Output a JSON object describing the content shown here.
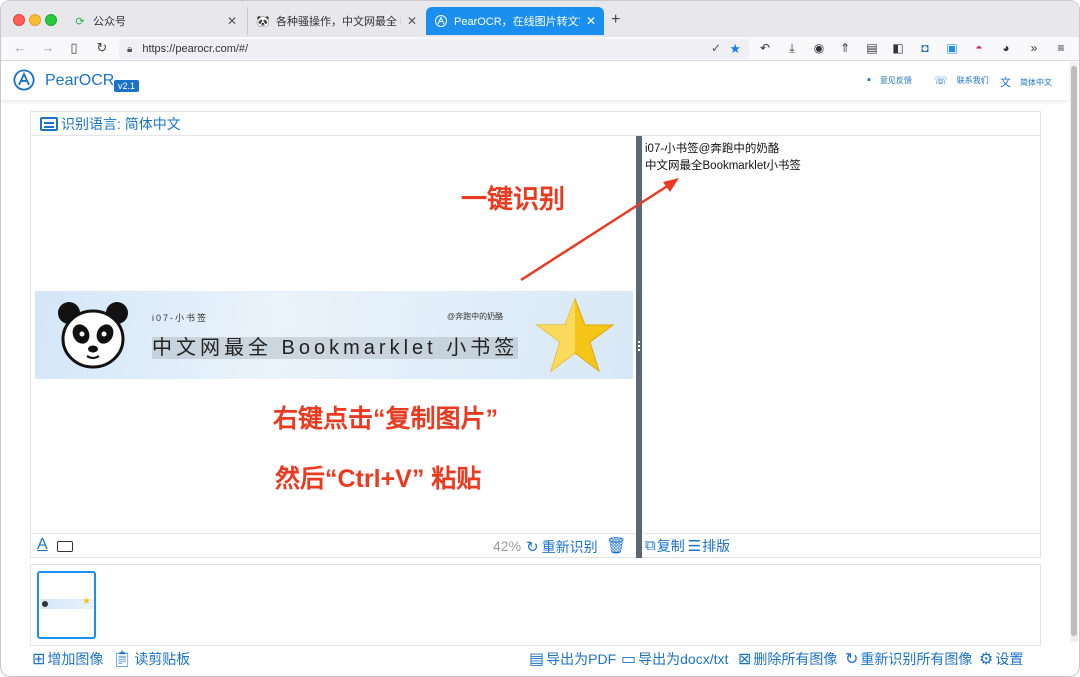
{
  "browser": {
    "tabs": [
      {
        "title": "公众号",
        "icon": "wechat-refresh-icon",
        "active": false
      },
      {
        "title": "各种骚操作，中文网最全 Bookmarklet",
        "icon": "panda-icon",
        "active": false
      },
      {
        "title": "PearOCR，在线图片转文字，免费",
        "icon": "pearocr-icon",
        "active": true
      }
    ],
    "url": "https://pearocr.com/#/",
    "accent": "#1a8ff0"
  },
  "app": {
    "name": "PearOCR",
    "version": "v2.1",
    "header_links": [
      {
        "label": "意见反馈",
        "icon": "feedback-icon"
      },
      {
        "label": "联系我们",
        "icon": "phone-icon"
      },
      {
        "label": "简体中文",
        "icon": "translate-icon"
      }
    ],
    "brand_color": "#1a73c9"
  },
  "main": {
    "lang_label": "识别语言: 简体中文",
    "banner": {
      "small_left": "i07-小书签",
      "small_right": "@奔跑中的奶酪",
      "big": "中文网最全 Bookmarklet 小书签"
    },
    "annotations": {
      "one_click": "一键识别",
      "right_click": "右键点击“复制图片”",
      "paste": "然后“Ctrl+V” 粘贴"
    },
    "annotation_color": "#ec3a20",
    "result_lines": [
      "i07-小书签@奔跑中的奶酪",
      "中文网最全Bookmarklet小书签"
    ],
    "progress_percent": "42%",
    "reocr_label": "重新识别",
    "copy_label": "复制",
    "layout_label": "排版"
  },
  "bottom": {
    "add_image": "增加图像",
    "read_clipboard": "读剪贴板",
    "export_pdf": "导出为PDF",
    "export_docx": "导出为docx/txt",
    "delete_all": "删除所有图像",
    "reocr_all": "重新识别所有图像",
    "settings": "设置"
  }
}
